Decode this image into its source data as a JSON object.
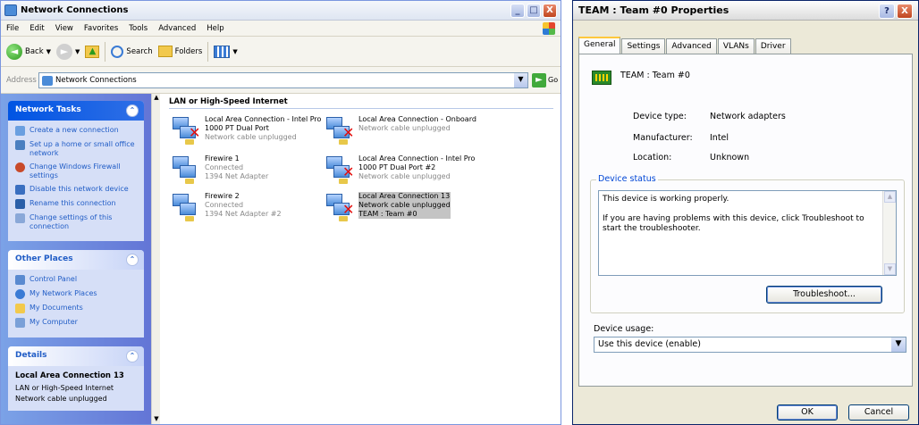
{
  "left_window": {
    "title": "Network Connections",
    "caption_buttons": {
      "minimize": "_",
      "maximize": "□",
      "close": "X"
    },
    "menu": [
      "File",
      "Edit",
      "View",
      "Favorites",
      "Tools",
      "Advanced",
      "Help"
    ],
    "toolbar": {
      "back": "Back",
      "search": "Search",
      "folders": "Folders"
    },
    "address": {
      "label": "Address",
      "value": "Network Connections",
      "go": "Go"
    },
    "network_tasks": {
      "title": "Network Tasks",
      "items": [
        {
          "label": "Create a new connection",
          "icon": "new-connection-icon"
        },
        {
          "label": "Set up a home or small office network",
          "icon": "home-network-icon"
        },
        {
          "label": "Change Windows Firewall settings",
          "icon": "firewall-icon"
        },
        {
          "label": "Disable this network device",
          "icon": "disable-device-icon"
        },
        {
          "label": "Rename this connection",
          "icon": "rename-icon"
        },
        {
          "label": "Change settings of this connection",
          "icon": "settings-icon"
        }
      ]
    },
    "other_places": {
      "title": "Other Places",
      "items": [
        {
          "label": "Control Panel",
          "icon": "control-panel-icon"
        },
        {
          "label": "My Network Places",
          "icon": "network-places-icon"
        },
        {
          "label": "My Documents",
          "icon": "documents-icon"
        },
        {
          "label": "My Computer",
          "icon": "computer-icon"
        }
      ]
    },
    "details": {
      "title": "Details",
      "name": "Local Area Connection 13",
      "type": "LAN or High-Speed Internet",
      "status": "Network cable unplugged"
    },
    "group_header": "LAN or High-Speed Internet",
    "connections": [
      {
        "name": "Local Area Connection - Intel Pro 1000 PT Dual Port",
        "status": "Network cable unplugged",
        "device": ""
      },
      {
        "name": "Local Area Connection - Onboard",
        "status": "Network cable unplugged",
        "device": ""
      },
      {
        "name": "Firewire 1",
        "status": "Connected",
        "device": "1394 Net Adapter"
      },
      {
        "name": "Local Area Connection - Intel Pro 1000 PT Dual Port #2",
        "status": "Network cable unplugged",
        "device": ""
      },
      {
        "name": "Firewire 2",
        "status": "Connected",
        "device": "1394 Net Adapter #2"
      },
      {
        "name": "Local Area Connection 13",
        "status": "Network cable unplugged",
        "device": "TEAM : Team #0"
      }
    ]
  },
  "right_window": {
    "title": "TEAM : Team #0 Properties",
    "help_button": "?",
    "close_button": "X",
    "tabs": [
      "General",
      "Settings",
      "Advanced",
      "VLANs",
      "Driver"
    ],
    "active_tab": "General",
    "device_name": "TEAM : Team #0",
    "properties": {
      "device_type_label": "Device type:",
      "device_type": "Network adapters",
      "manufacturer_label": "Manufacturer:",
      "manufacturer": "Intel",
      "location_label": "Location:",
      "location": "Unknown"
    },
    "device_status": {
      "legend": "Device status",
      "line1": "This device is working properly.",
      "line2": "If you are having problems with this device, click Troubleshoot to start the troubleshooter."
    },
    "troubleshoot_button": "Troubleshoot...",
    "device_usage": {
      "label": "Device usage:",
      "value": "Use this device (enable)"
    },
    "ok_button": "OK",
    "cancel_button": "Cancel"
  }
}
